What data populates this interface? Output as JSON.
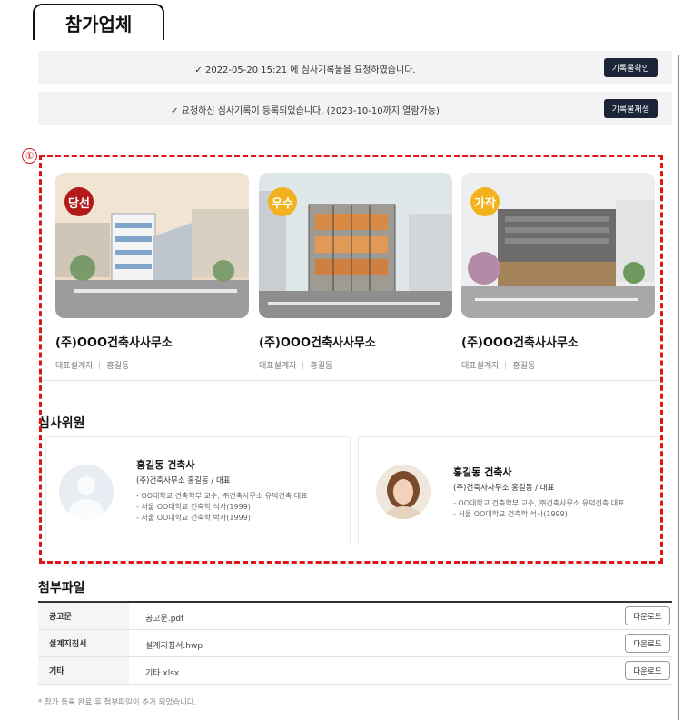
{
  "header": {
    "title": "참가업체"
  },
  "notices": [
    {
      "message": "✓ 2022-05-20 15:21 에 심사기록물을 요청하였습니다.",
      "button": "기록물확인"
    },
    {
      "message": "✓ 요청하신 심사기록이 등록되었습니다. (2023-10-10까지 열람가능)",
      "button": "기록물재생"
    }
  ],
  "annotation_marker": "①",
  "participants": [
    {
      "badge": "당선",
      "badge_color": "#b31b1b",
      "name": "(주)OOO건축사사무소",
      "role": "대표설계자",
      "designer": "홍길동"
    },
    {
      "badge": "우수",
      "badge_color": "#f2b21d",
      "name": "(주)OOO건축사사무소",
      "role": "대표설계자",
      "designer": "홍길동"
    },
    {
      "badge": "가작",
      "badge_color": "#f2b21d",
      "name": "(주)OOO건축사사무소",
      "role": "대표설계자",
      "designer": "홍길동"
    }
  ],
  "judges_section": {
    "title": "심사위원",
    "judges": [
      {
        "name": "홍길동 건축사",
        "affiliation": "(주)건축사무소 홍길동 / 대표",
        "career": [
          "- OO대학교 건축학부 교수, ㈜건축사무소 유덕건축 대표",
          "- 서울 OO대학교 건축학 석사(1999)",
          "- 서울 OO대학교 건축학 박사(1999)"
        ]
      },
      {
        "name": "홍길동 건축사",
        "affiliation": "(주)건축사사무소 홍길동 / 대표",
        "career": [
          "- OO대학교 건축학부 교수, ㈜건축사무소 유덕건축 대표",
          "- 서울 OO대학교 건축학 석사(1999)"
        ]
      }
    ]
  },
  "attachments": {
    "title": "첨부파일",
    "rows": [
      {
        "label": "공고문",
        "file": "공고문.pdf",
        "button": "다운로드"
      },
      {
        "label": "설계지침서",
        "file": "설계지침서.hwp",
        "button": "다운로드"
      },
      {
        "label": "기타",
        "file": "기타.xlsx",
        "button": "다운로드"
      }
    ],
    "note": "* 참가 등록 완료 후 첨부파일이 추가 되었습니다."
  }
}
